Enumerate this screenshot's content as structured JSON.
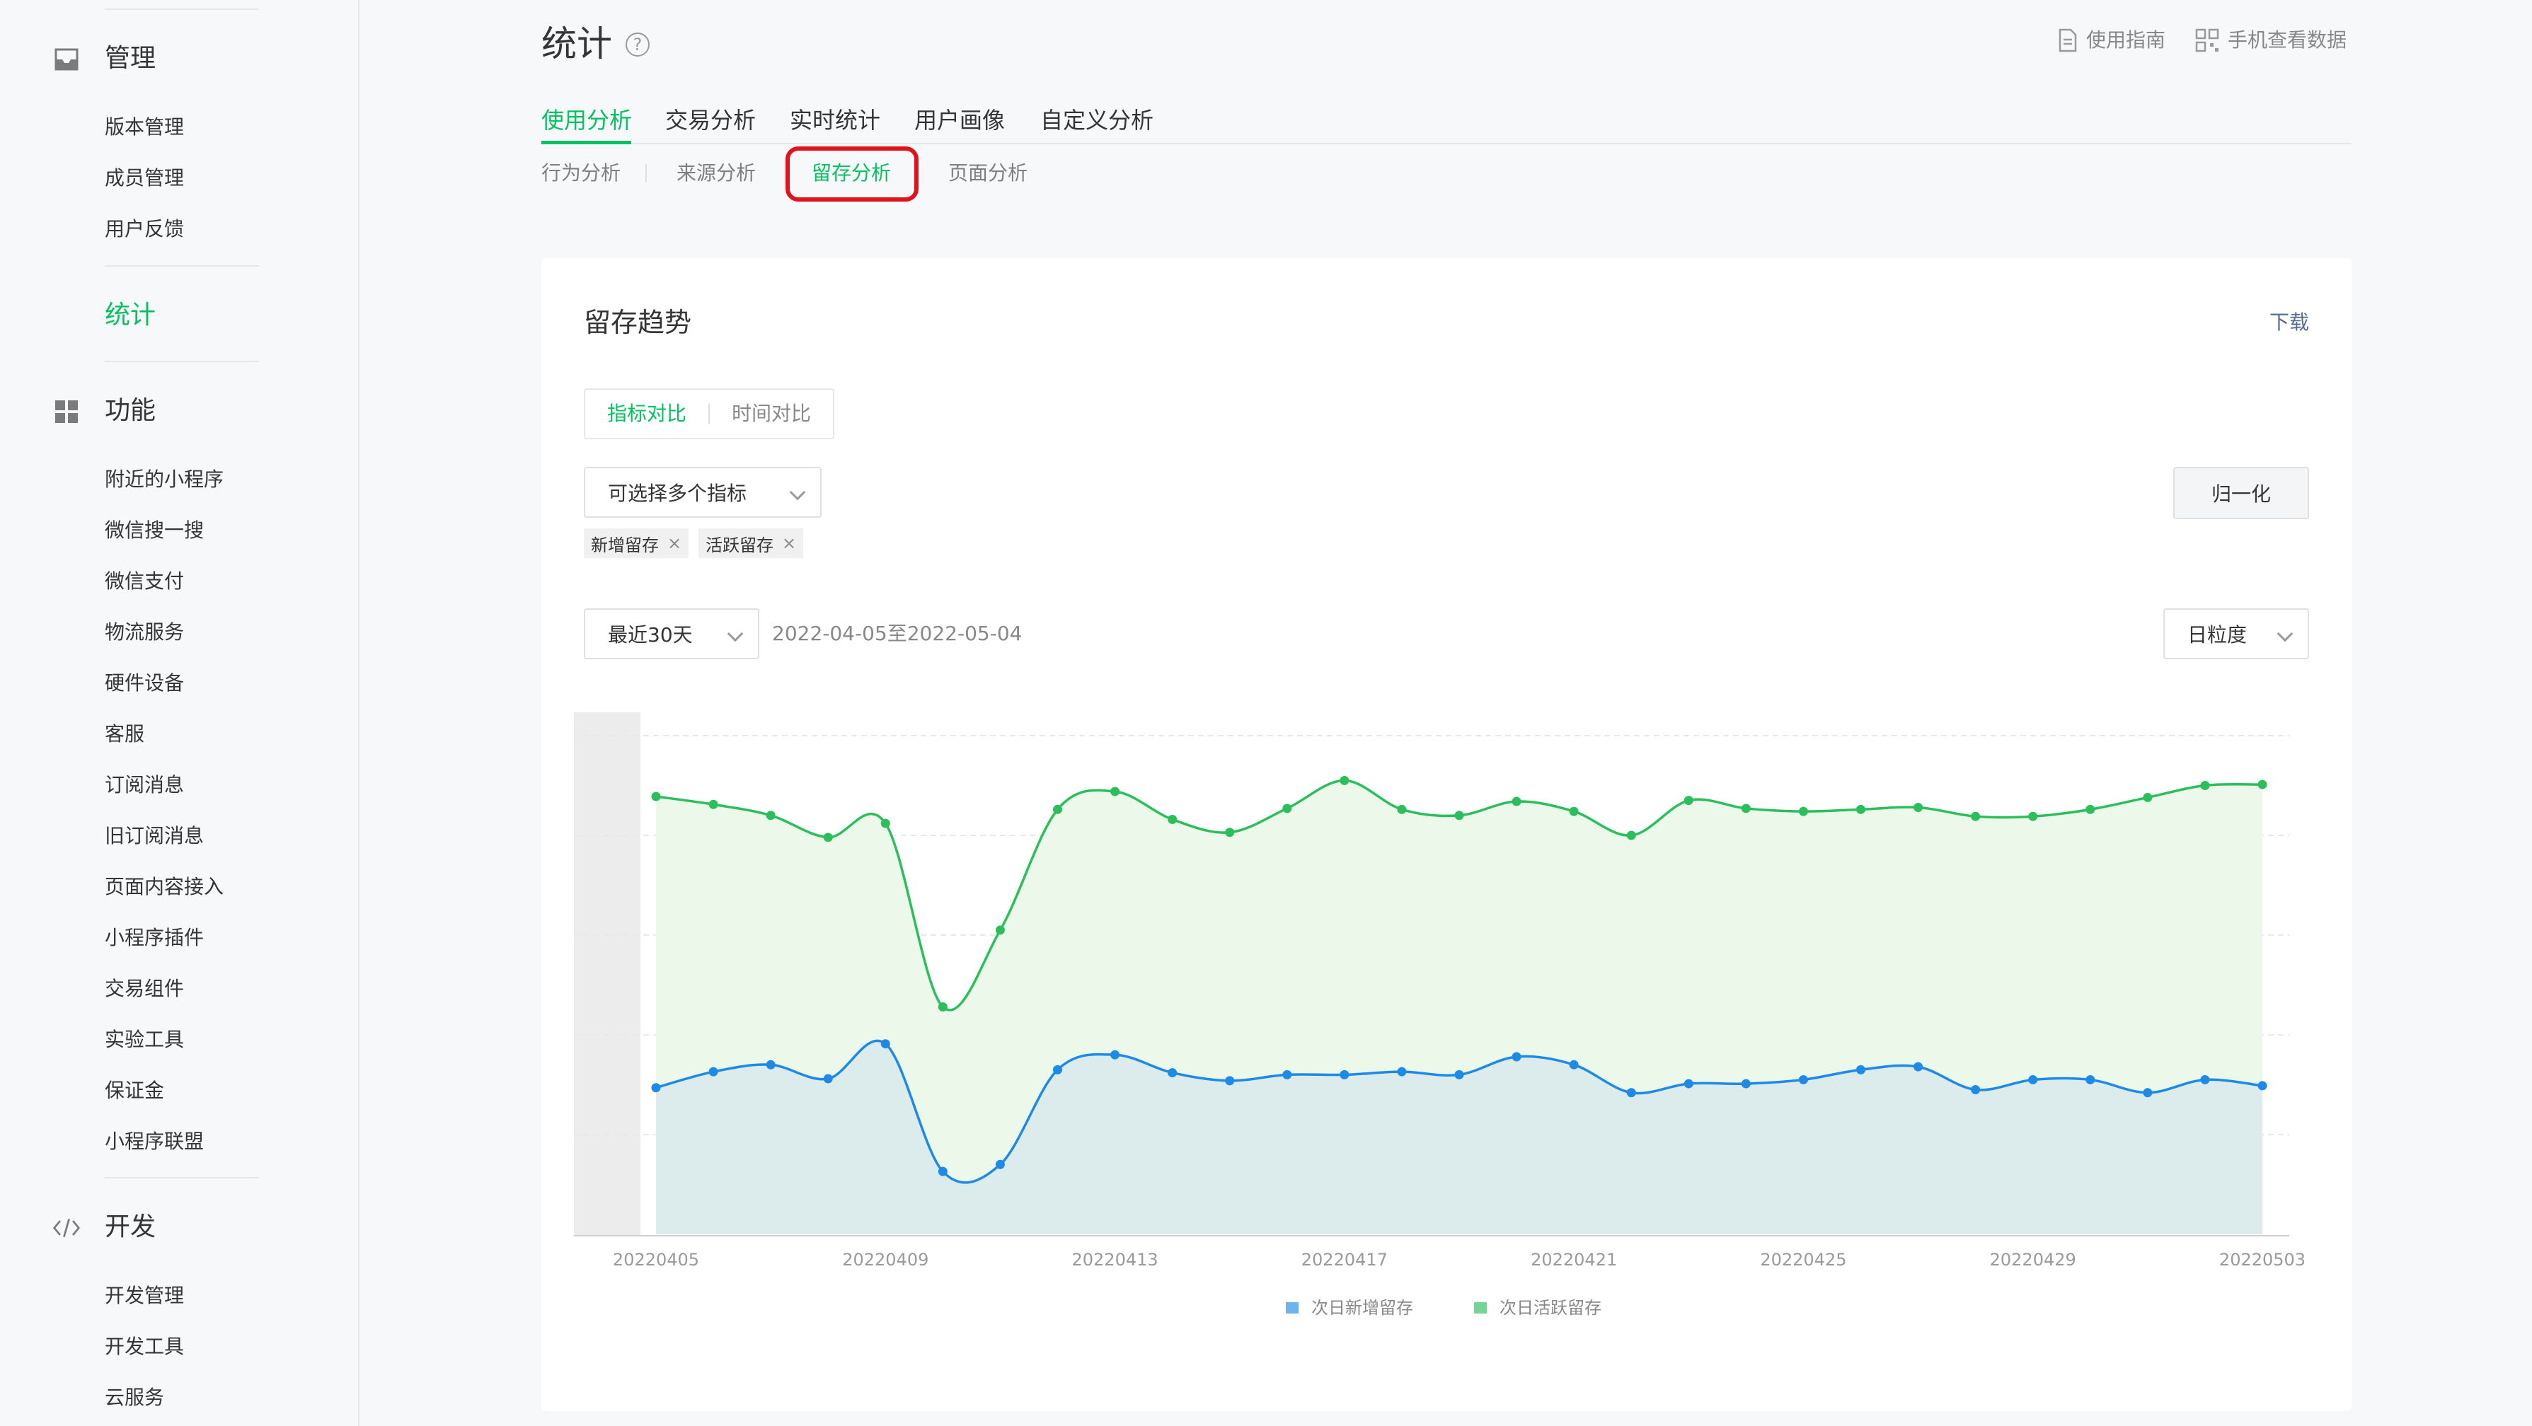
{
  "sidebar": {
    "groups": [
      {
        "title": "管理",
        "icon": "inbox-icon",
        "items": [
          "版本管理",
          "成员管理",
          "用户反馈"
        ]
      },
      {
        "title": "统计",
        "active": true
      },
      {
        "title": "功能",
        "icon": "grid-icon",
        "items": [
          "附近的小程序",
          "微信搜一搜",
          "微信支付",
          "物流服务",
          "硬件设备",
          "客服",
          "订阅消息",
          "旧订阅消息",
          "页面内容接入",
          "小程序插件",
          "交易组件",
          "实验工具",
          "保证金",
          "小程序联盟"
        ]
      },
      {
        "title": "开发",
        "icon": "code-icon",
        "items": [
          "开发管理",
          "开发工具",
          "云服务"
        ]
      }
    ]
  },
  "header": {
    "title": "统计",
    "help_icon": "question-circle-icon",
    "links": [
      {
        "label": "使用指南",
        "icon": "document-icon"
      },
      {
        "label": "手机查看数据",
        "icon": "qrcode-icon"
      }
    ],
    "main_tabs": [
      "使用分析",
      "交易分析",
      "实时统计",
      "用户画像",
      "自定义分析"
    ],
    "active_main_tab": "使用分析",
    "sub_tabs": [
      "行为分析",
      "来源分析",
      "留存分析",
      "页面分析"
    ],
    "active_sub_tab": "留存分析"
  },
  "card": {
    "title": "留存趋势",
    "download_label": "下载",
    "segment": {
      "items": [
        "指标对比",
        "时间对比"
      ],
      "active": "指标对比"
    },
    "metric_select": {
      "value": "可选择多个指标"
    },
    "tags": [
      "新增留存",
      "活跃留存"
    ],
    "normalize_button": "归一化",
    "range_select": {
      "value": "最近30天"
    },
    "date_range": "2022-04-05至2022-05-04",
    "granularity_select": {
      "value": "日粒度"
    }
  },
  "chart_data": {
    "type": "area",
    "x": [
      "20220405",
      "20220406",
      "20220407",
      "20220408",
      "20220409",
      "20220410",
      "20220411",
      "20220412",
      "20220413",
      "20220414",
      "20220415",
      "20220416",
      "20220417",
      "20220418",
      "20220419",
      "20220420",
      "20220421",
      "20220422",
      "20220423",
      "20220424",
      "20220425",
      "20220426",
      "20220427",
      "20220428",
      "20220429",
      "20220430",
      "20220501",
      "20220502",
      "20220503"
    ],
    "x_tick_labels": [
      "20220405",
      "20220409",
      "20220413",
      "20220417",
      "20220421",
      "20220425",
      "20220429",
      "20220503"
    ],
    "series": [
      {
        "name": "次日新增留存",
        "color": "#1e8ae8",
        "fill": "#dcecec",
        "values": [
          1.47,
          1.63,
          1.7,
          1.56,
          1.91,
          0.63,
          0.7,
          1.65,
          1.8,
          1.62,
          1.54,
          1.6,
          1.6,
          1.63,
          1.6,
          1.78,
          1.7,
          1.42,
          1.51,
          1.51,
          1.55,
          1.65,
          1.68,
          1.45,
          1.55,
          1.55,
          1.42,
          1.55,
          1.49
        ]
      },
      {
        "name": "次日活跃留存",
        "color": "#2bbf5b",
        "fill": "#ebf8ea",
        "values": [
          4.39,
          4.31,
          4.2,
          3.98,
          4.12,
          2.28,
          3.05,
          4.26,
          4.44,
          4.16,
          4.03,
          4.27,
          4.55,
          4.26,
          4.2,
          4.34,
          4.24,
          4.0,
          4.35,
          4.27,
          4.24,
          4.26,
          4.28,
          4.19,
          4.19,
          4.26,
          4.38,
          4.5,
          4.51
        ]
      }
    ],
    "ylim": [
      0,
      5
    ],
    "grid": true,
    "legend_position": "bottom-center"
  }
}
